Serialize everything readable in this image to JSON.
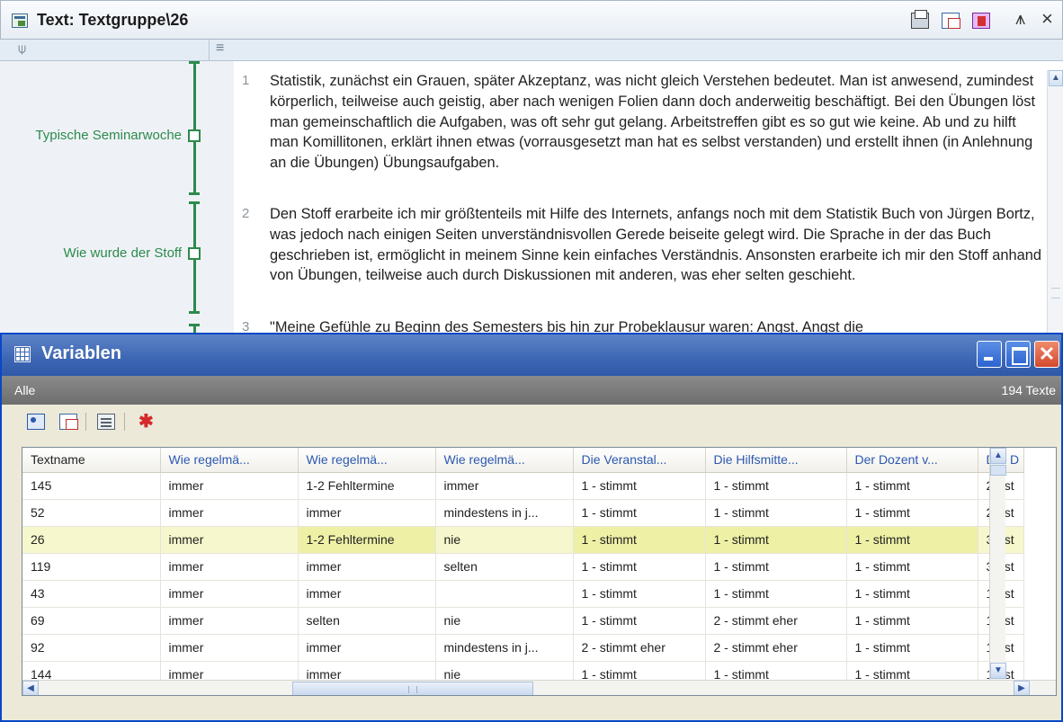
{
  "text_window": {
    "title": "Text: Textgruppe\\26",
    "codes": [
      {
        "label": "Typische Seminarwoche"
      },
      {
        "label": "Wie wurde der Stoff"
      }
    ],
    "paragraphs": [
      {
        "num": "1",
        "text": "Statistik, zunächst ein Grauen, später Akzeptanz, was nicht gleich Verstehen bedeutet. Man ist anwesend, zumindest körperlich, teilweise auch geistig, aber nach wenigen Folien dann doch anderweitig beschäftigt. Bei den Übungen löst man gemeinschaftlich die Aufgaben, was oft sehr gut gelang. Arbeitstreffen gibt es so gut wie keine. Ab und zu hilft man Komillitonen, erklärt ihnen etwas (vorrausgesetzt man hat es selbst verstanden) und erstellt ihnen (in Anlehnung an die Übungen) Übungsaufgaben."
      },
      {
        "num": "2",
        "text": "Den Stoff erarbeite ich mir größtenteils mit Hilfe des Internets, anfangs noch mit dem Statistik Buch von Jürgen Bortz, was jedoch nach einigen Seiten unverständnisvollen Gerede beiseite gelegt wird. Die Sprache in der das Buch geschrieben ist, ermöglicht in meinem Sinne kein einfaches Verständnis. Ansonsten erarbeite ich mir den Stoff anhand von Übungen, teilweise auch durch Diskussionen mit anderen, was eher selten geschieht."
      },
      {
        "num": "3",
        "text": "\"Meine Gefühle zu Beginn des Semesters bis hin zur Probeklausur waren: Angst. Angst die"
      }
    ]
  },
  "var_window": {
    "title": "Variablen",
    "filter_label": "Alle",
    "count": "194 Texte",
    "toolbar_icons": [
      "export-icon",
      "copy-icon",
      "select-icon",
      "run-icon"
    ],
    "columns": [
      "Textname",
      "Wie regelmä...",
      "Wie regelmä...",
      "Wie regelmä...",
      "Die Veranstal...",
      "Die Hilfsmitte...",
      "Der Dozent v...",
      "Der D"
    ],
    "rows": [
      [
        "145",
        "immer",
        "1-2 Fehltermine",
        "immer",
        "1 - stimmt",
        "1 - stimmt",
        "1 - stimmt",
        "2 - st"
      ],
      [
        "52",
        "immer",
        "immer",
        "mindestens in j...",
        "1 - stimmt",
        "1 - stimmt",
        "1 - stimmt",
        "2 - st"
      ],
      [
        "26",
        "immer",
        "1-2 Fehltermine",
        "nie",
        "1 - stimmt",
        "1 - stimmt",
        "1 - stimmt",
        "3 - st"
      ],
      [
        "119",
        "immer",
        "immer",
        "selten",
        "1 - stimmt",
        "1 - stimmt",
        "1 - stimmt",
        "3 - st"
      ],
      [
        "43",
        "immer",
        "immer",
        "",
        "1 - stimmt",
        "1 - stimmt",
        "1 - stimmt",
        "1 - st"
      ],
      [
        "69",
        "immer",
        "selten",
        "nie",
        "1 - stimmt",
        "2 - stimmt eher",
        "1 - stimmt",
        "1 - st"
      ],
      [
        "92",
        "immer",
        "immer",
        "mindestens in j...",
        "2 - stimmt eher",
        "2 - stimmt eher",
        "1 - stimmt",
        "1 - st"
      ],
      [
        "144",
        "immer",
        "immer",
        "nie",
        "1 - stimmt",
        "1 - stimmt",
        "1 - stimmt",
        "1 - st"
      ]
    ],
    "selected_row": "26"
  },
  "colors": {
    "code_green": "#2d8a4c",
    "titlebar_blue": "#3d66b3",
    "selected_row": "#f6f7cc",
    "column_header_text": "#2c58b0"
  }
}
